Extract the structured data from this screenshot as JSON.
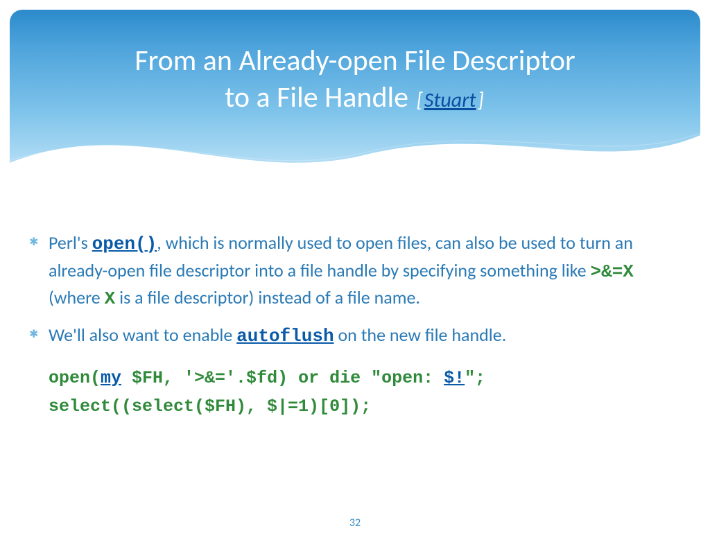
{
  "title": {
    "line1": "From an Already-open File Descriptor",
    "line2_prefix": "to a File Handle ",
    "bracket_open": "[",
    "citation": "Stuart",
    "bracket_close": "]"
  },
  "bullets": {
    "b1_pre": "Perl's ",
    "b1_open": "open()",
    "b1_mid1": ", which is normally used to open files, can also be used to turn an already-open file descriptor into a file handle by specifying something like ",
    "b1_mode": ">&=X",
    "b1_mid2": " (where ",
    "b1_x": "X",
    "b1_post": " is a file descriptor) instead of a file name.",
    "b2_pre": "We'll also want to enable ",
    "b2_autoflush": "autoflush",
    "b2_post": " on the new file handle."
  },
  "code": {
    "l1_a": "open(",
    "l1_my": "my",
    "l1_b": " $FH, '>&='.$fd) or die \"open: ",
    "l1_err": "$!",
    "l1_c": "\";",
    "l2": "select((select($FH), $|=1)[0]);"
  },
  "page_number": "32"
}
